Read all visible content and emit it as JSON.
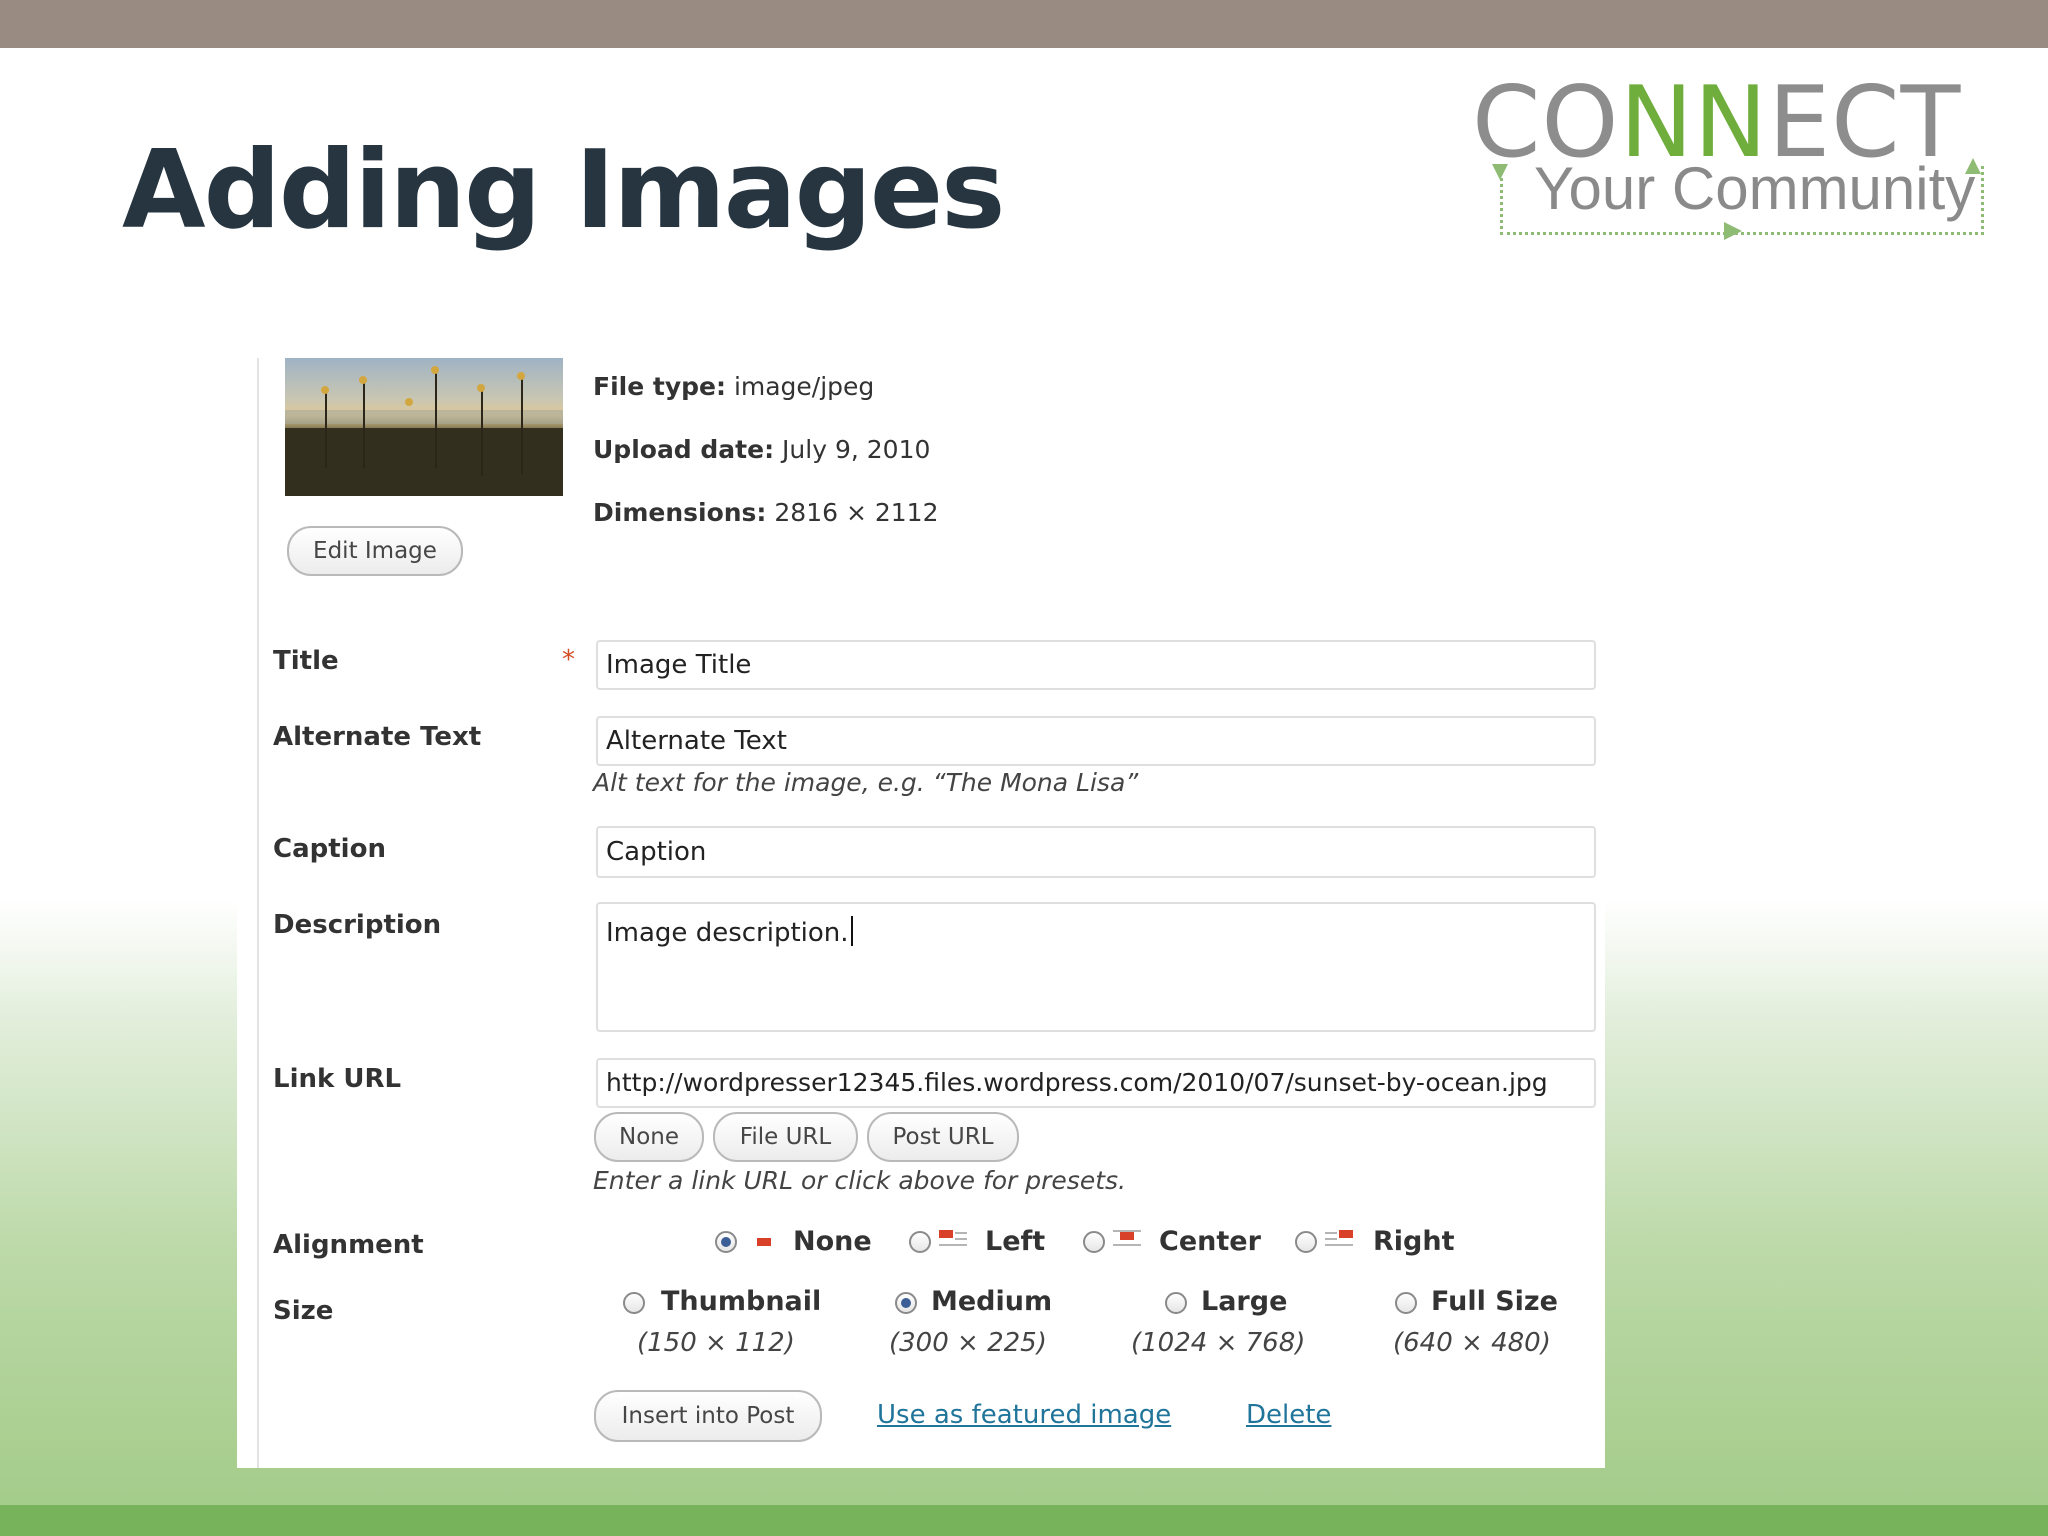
{
  "slide": {
    "title": "Adding Images",
    "logo": {
      "line1_a": "CO",
      "line1_b": "NN",
      "line1_c": "ECT",
      "line2": "Your Community"
    }
  },
  "media": {
    "edit_image_label": "Edit Image",
    "file_type": {
      "label": "File type:",
      "value": "image/jpeg"
    },
    "upload_date": {
      "label": "Upload date:",
      "value": "July 9, 2010"
    },
    "dimensions": {
      "label": "Dimensions:",
      "value": "2816 × 2112"
    }
  },
  "form": {
    "title": {
      "label": "Title",
      "required_mark": "*",
      "value": "Image Title"
    },
    "alt": {
      "label": "Alternate Text",
      "value": "Alternate Text",
      "help": "Alt text for the image, e.g. “The Mona Lisa”"
    },
    "caption": {
      "label": "Caption",
      "value": "Caption"
    },
    "description": {
      "label": "Description",
      "value": "Image description."
    },
    "link_url": {
      "label": "Link URL",
      "value": "http://wordpresser12345.files.wordpress.com/2010/07/sunset-by-ocean.jpg",
      "buttons": [
        "None",
        "File URL",
        "Post URL"
      ],
      "help": "Enter a link URL or click above for presets."
    },
    "alignment": {
      "label": "Alignment",
      "options": [
        "None",
        "Left",
        "Center",
        "Right"
      ],
      "selected": "None"
    },
    "size": {
      "label": "Size",
      "options": [
        {
          "name": "Thumbnail",
          "dims": "(150 × 112)"
        },
        {
          "name": "Medium",
          "dims": "(300 × 225)"
        },
        {
          "name": "Large",
          "dims": "(1024 × 768)"
        },
        {
          "name": "Full Size",
          "dims": "(640 × 480)"
        }
      ],
      "selected": "Medium"
    },
    "actions": {
      "insert": "Insert into Post",
      "featured": "Use as featured image",
      "delete": "Delete"
    }
  },
  "colors": {
    "top_bar": "#9a8b82",
    "bottom_bar": "#76b35a",
    "title": "#273540",
    "link": "#21759b",
    "logo_green": "#6fae3c"
  }
}
